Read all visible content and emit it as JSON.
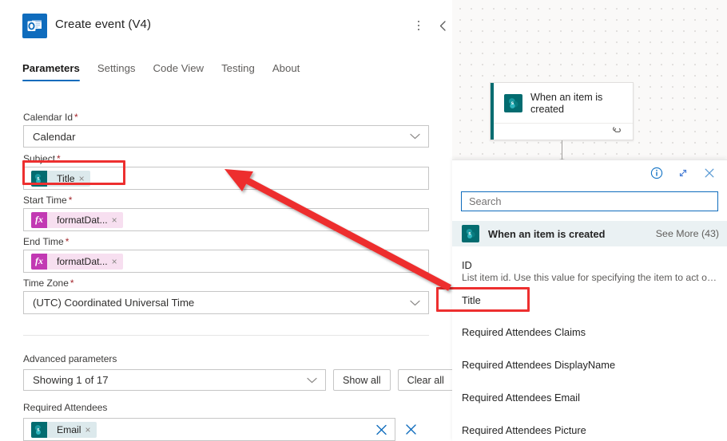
{
  "action_card": {
    "title": "Create event (V4)",
    "app_icon": "outlook-icon",
    "more_options": "more-options-icon",
    "collapse": "collapse-icon",
    "tabs": [
      {
        "label": "Parameters",
        "active": true
      },
      {
        "label": "Settings",
        "active": false
      },
      {
        "label": "Code View",
        "active": false
      },
      {
        "label": "Testing",
        "active": false
      },
      {
        "label": "About",
        "active": false
      }
    ],
    "fields": [
      {
        "label": "Calendar Id",
        "required": true,
        "kind": "dropdown",
        "value": "Calendar"
      },
      {
        "label": "Subject",
        "required": true,
        "kind": "token",
        "token": {
          "type": "sharepoint",
          "label": "Title",
          "remove": "×"
        }
      },
      {
        "label": "Start Time",
        "required": true,
        "kind": "token",
        "token": {
          "type": "expression",
          "label": "formatDat...",
          "remove": "×"
        }
      },
      {
        "label": "End Time",
        "required": true,
        "kind": "token",
        "token": {
          "type": "expression",
          "label": "formatDat...",
          "remove": "×"
        }
      },
      {
        "label": "Time Zone",
        "required": true,
        "kind": "dropdown",
        "value": "(UTC) Coordinated Universal Time"
      }
    ],
    "advanced": {
      "label": "Advanced parameters",
      "select_value": "Showing 1 of 17",
      "show_all_label": "Show all",
      "clear_all_label": "Clear all"
    },
    "attendees": {
      "label": "Required Attendees",
      "token": {
        "type": "sharepoint",
        "label": "Email",
        "remove": "×"
      },
      "clear_icon": "clear-icon",
      "remove_icon": "remove-parameter-icon"
    }
  },
  "canvas": {
    "node": {
      "title": "When an item is created",
      "icon": "sharepoint-icon",
      "footer_icon": "connection-icon"
    }
  },
  "dynamic_panel": {
    "toolbar": {
      "info_icon": "info-icon",
      "expand_icon": "expand-icon",
      "close_icon": "close-icon"
    },
    "search": {
      "placeholder": "Search",
      "value": ""
    },
    "group": {
      "title": "When an item is created",
      "icon": "sharepoint-icon",
      "see_more": "See More (43)"
    },
    "items": [
      {
        "name": "ID",
        "description": "List item id. Use this value for specifying the item to act on in other lis..."
      },
      {
        "name": "Title",
        "description": ""
      },
      {
        "name": "Required Attendees Claims",
        "description": ""
      },
      {
        "name": "Required Attendees DisplayName",
        "description": ""
      },
      {
        "name": "Required Attendees Email",
        "description": ""
      },
      {
        "name": "Required Attendees Picture",
        "description": ""
      }
    ]
  },
  "annotations": {
    "highlight_color": "#ed2f2f",
    "arrow": {
      "from": "Title dynamic content item",
      "to": "Subject field"
    }
  }
}
